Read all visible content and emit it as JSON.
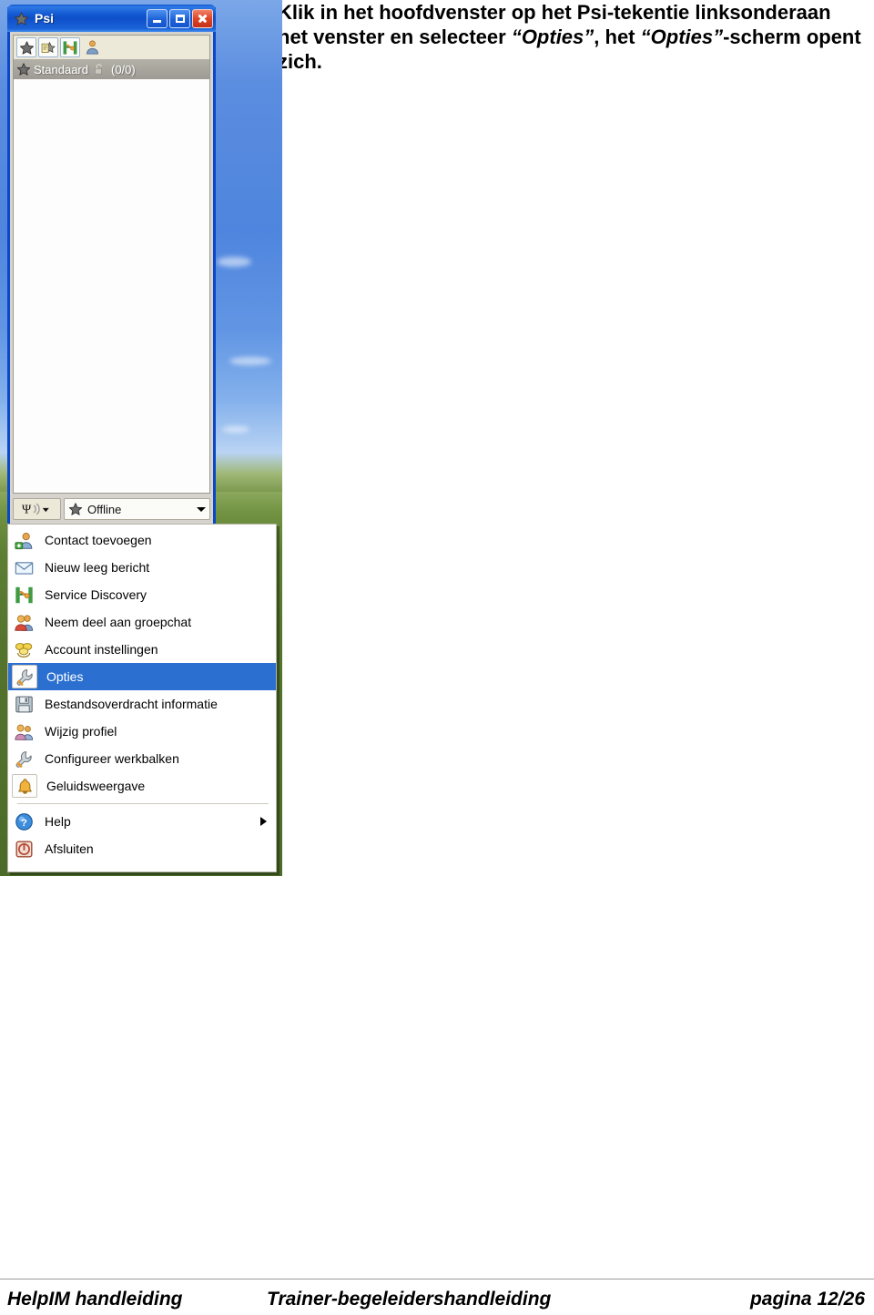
{
  "intro": {
    "line1_a": "Klik in het hoofdvenster op het Psi-tekentie",
    "line1_b": "linksonderaan het venster en selecteer ",
    "quote1": "“Opties”",
    "line1_c": ", het",
    "quote2": "“Opties”",
    "line2_c": "-scherm opent zich."
  },
  "psi_window": {
    "title": "Psi",
    "title_icon": "star-icon",
    "buttons": {
      "minimize": "minimize-icon",
      "maximize": "maximize-icon",
      "close": "close-icon"
    },
    "toolbar": [
      {
        "name": "add-contact-star-icon"
      },
      {
        "name": "new-message-icon"
      },
      {
        "name": "service-discovery-icon"
      },
      {
        "name": "profile-icon"
      }
    ],
    "group_row": {
      "icon": "star-icon",
      "name": "Standaard",
      "lock_icon": "unlocked-padlock-icon",
      "count": "(0/0)"
    },
    "statusbar": {
      "psi_button_icon": "psi-signal-icon",
      "status_icon": "star-icon",
      "status_label": "Offline",
      "dropdown_icon": "chevron-down-icon"
    }
  },
  "menu": {
    "items": [
      {
        "label": "Contact toevoegen",
        "icon": "add-contact-icon",
        "selected": false,
        "framed": false,
        "submenu": false
      },
      {
        "label": "Nieuw leeg bericht",
        "icon": "envelope-icon",
        "selected": false,
        "framed": false,
        "submenu": false
      },
      {
        "label": "Service Discovery",
        "icon": "service-discovery-icon",
        "selected": false,
        "framed": false,
        "submenu": false
      },
      {
        "label": "Neem deel aan groepchat",
        "icon": "group-chat-icon",
        "selected": false,
        "framed": false,
        "submenu": false
      },
      {
        "label": "Account instellingen",
        "icon": "accounts-icon",
        "selected": false,
        "framed": false,
        "submenu": false
      },
      {
        "label": "Opties",
        "icon": "wrench-icon",
        "selected": true,
        "framed": true,
        "submenu": false
      },
      {
        "label": "Bestandsoverdracht informatie",
        "icon": "floppy-disk-icon",
        "selected": false,
        "framed": false,
        "submenu": false
      },
      {
        "label": "Wijzig profiel",
        "icon": "edit-profile-icon",
        "selected": false,
        "framed": false,
        "submenu": false
      },
      {
        "label": "Configureer werkbalken",
        "icon": "wrench-icon",
        "selected": false,
        "framed": false,
        "submenu": false
      },
      {
        "label": "Geluidsweergave",
        "icon": "bell-icon",
        "selected": false,
        "framed": true,
        "submenu": false
      },
      {
        "separator": true
      },
      {
        "label": "Help",
        "icon": "help-circle-icon",
        "selected": false,
        "framed": false,
        "submenu": true
      },
      {
        "label": "Afsluiten",
        "icon": "power-icon",
        "selected": false,
        "framed": false,
        "submenu": false
      }
    ]
  },
  "footer": {
    "left": "HelpIM handleiding",
    "middle": "Trainer-begeleidershandleiding",
    "right": "pagina 12/26"
  },
  "colors": {
    "titlebar_blue": "#1259d2",
    "window_frame": "#0a48c8",
    "menu_highlight": "#2b6fd0",
    "menu_bg": "#ffffff",
    "toolbar_bg": "#ece9d8",
    "group_row_gray": "#a5a29b",
    "desktop_sky": "#4f85de",
    "desktop_grass": "#54742d",
    "close_button_red": "#de4526"
  }
}
